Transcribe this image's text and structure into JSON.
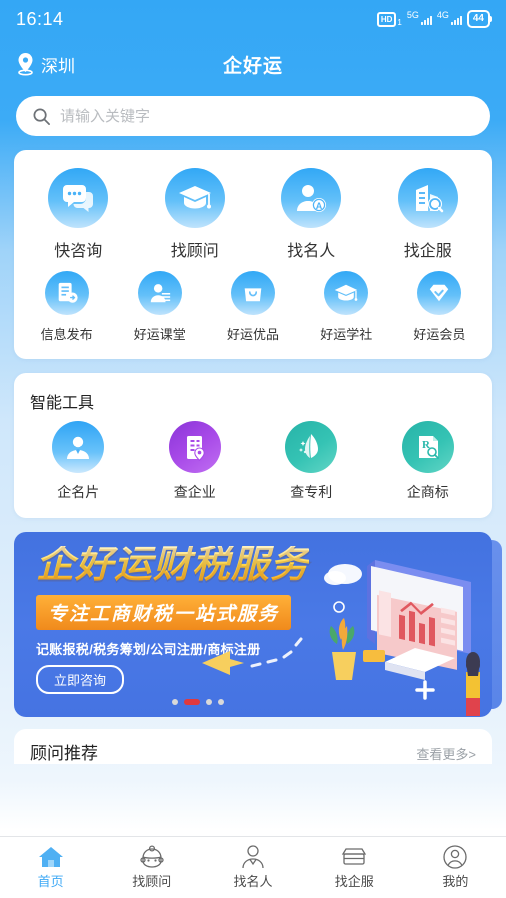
{
  "status_bar": {
    "time": "16:14",
    "hd_label": "HD",
    "hd_sub": "1",
    "net_primary": "5G",
    "net_secondary": "4G",
    "battery": "44"
  },
  "header": {
    "location": "深圳",
    "title": "企好运",
    "location_icon": "location-pin-icon"
  },
  "search": {
    "placeholder": "请输入关键字",
    "value": "",
    "icon": "search-icon"
  },
  "quick_entries": {
    "primary": [
      {
        "label": "快咨询",
        "icon": "chat-bubbles-icon"
      },
      {
        "label": "找顾问",
        "icon": "graduation-cap-icon"
      },
      {
        "label": "找名人",
        "icon": "person-badge-icon"
      },
      {
        "label": "找企服",
        "icon": "building-search-icon"
      }
    ],
    "secondary": [
      {
        "label": "信息发布",
        "icon": "document-publish-icon"
      },
      {
        "label": "好运课堂",
        "icon": "person-list-icon"
      },
      {
        "label": "好运优品",
        "icon": "shopping-bag-icon"
      },
      {
        "label": "好运学社",
        "icon": "graduation-cap-icon"
      },
      {
        "label": "好运会员",
        "icon": "diamond-check-icon"
      }
    ]
  },
  "tools": {
    "title": "智能工具",
    "items": [
      {
        "label": "企名片",
        "icon": "person-card-icon",
        "color": "#2fa4f5"
      },
      {
        "label": "查企业",
        "icon": "building-pin-icon",
        "color": "#a84ae8"
      },
      {
        "label": "查专利",
        "icon": "patent-p-icon",
        "color": "#27b3a8"
      },
      {
        "label": "企商标",
        "icon": "trademark-r-icon",
        "color": "#27b3a8"
      }
    ]
  },
  "banner": {
    "title": "企好运财税服务",
    "subtitle": "专注工商财税一站式服务",
    "description": "记账报税/税务筹划/公司注册/商标注册",
    "cta": "立即咨询",
    "slides_total": 4,
    "active_slide": 2,
    "accent_color": "#e0393e",
    "bg_color": "#4a79e6"
  },
  "recommend": {
    "title": "顾问推荐",
    "more": "查看更多>"
  },
  "tabbar": {
    "active_color": "#3fa9f5",
    "items": [
      {
        "label": "首页",
        "icon": "home-icon",
        "active": true
      },
      {
        "label": "找顾问",
        "icon": "advisor-face-icon",
        "active": false
      },
      {
        "label": "找名人",
        "icon": "person-suit-icon",
        "active": false
      },
      {
        "label": "找企服",
        "icon": "shop-icon",
        "active": false
      },
      {
        "label": "我的",
        "icon": "user-circle-icon",
        "active": false
      }
    ]
  }
}
